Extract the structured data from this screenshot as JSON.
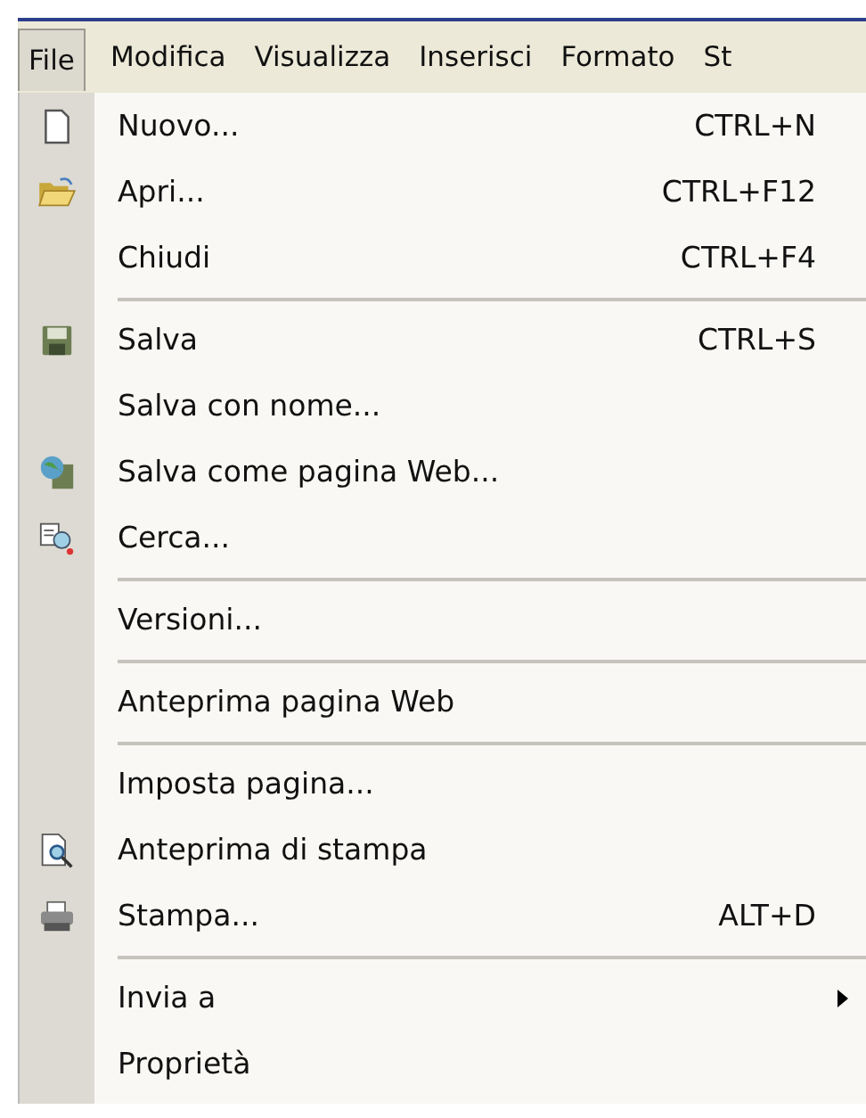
{
  "menu_bar": [
    {
      "label": "File",
      "selected": true
    },
    {
      "label": "Modifica",
      "selected": false
    },
    {
      "label": "Visualizza",
      "selected": false
    },
    {
      "label": "Inserisci",
      "selected": false
    },
    {
      "label": "Formato",
      "selected": false
    },
    {
      "label": "St",
      "selected": false
    }
  ],
  "menu": {
    "items": [
      {
        "kind": "item",
        "label": "Nuovo...",
        "shortcut": "CTRL+N"
      },
      {
        "kind": "item",
        "label": "Apri...",
        "shortcut": "CTRL+F12"
      },
      {
        "kind": "item",
        "label": "Chiudi",
        "shortcut": "CTRL+F4"
      },
      {
        "kind": "separator"
      },
      {
        "kind": "item",
        "label": "Salva",
        "shortcut": "CTRL+S"
      },
      {
        "kind": "item",
        "label": "Salva con nome..."
      },
      {
        "kind": "item",
        "label": "Salva come pagina Web..."
      },
      {
        "kind": "item",
        "label": "Cerca..."
      },
      {
        "kind": "separator"
      },
      {
        "kind": "item",
        "label": "Versioni..."
      },
      {
        "kind": "separator"
      },
      {
        "kind": "item",
        "label": "Anteprima pagina Web"
      },
      {
        "kind": "separator"
      },
      {
        "kind": "item",
        "label": "Imposta pagina..."
      },
      {
        "kind": "item",
        "label": "Anteprima di stampa"
      },
      {
        "kind": "item",
        "label": "Stampa...",
        "shortcut": "ALT+D"
      },
      {
        "kind": "separator"
      },
      {
        "kind": "item",
        "label": "Invia a",
        "submenu": true
      },
      {
        "kind": "item",
        "label": "Proprietà"
      }
    ]
  }
}
